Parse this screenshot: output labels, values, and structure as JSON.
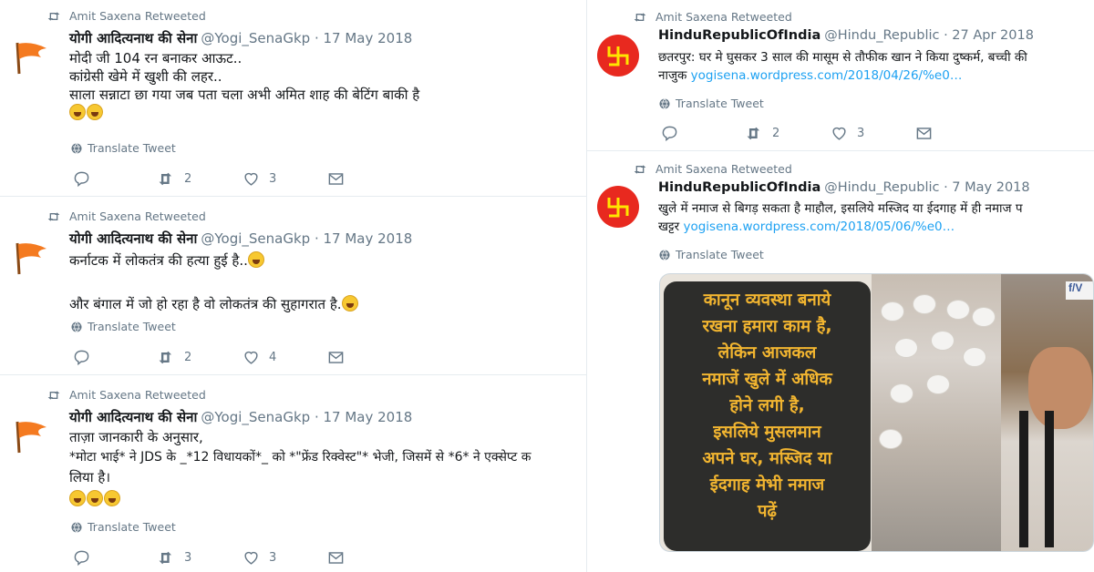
{
  "left_tweets": [
    {
      "retweeted_by": "Amit Saxena Retweeted",
      "name": "योगी आदित्यनाथ की सेना",
      "meta": "@Yogi_SenaGkp · 17 May 2018",
      "lines": [
        "मोदी जी 104 रन बनाकर आऊट..",
        "कांग्रेसी खेमे में खुशी की लहर..",
        "साला सन्नाटा छा गया जब पता चला अभी अमित शाह की बेटिंग बाकी है"
      ],
      "translate": "Translate Tweet",
      "reply_count": "",
      "retweet_count": "2",
      "like_count": "3"
    },
    {
      "retweeted_by": "Amit Saxena Retweeted",
      "name": "योगी आदित्यनाथ की सेना",
      "meta": "@Yogi_SenaGkp · 17 May 2018",
      "lines": [
        "कर्नाटक में लोकतंत्र की हत्या हुई है..",
        "",
        "और बंगाल में जो हो रहा है वो लोकतंत्र की सुहागरात है."
      ],
      "translate": "Translate Tweet",
      "reply_count": "",
      "retweet_count": "2",
      "like_count": "4"
    },
    {
      "retweeted_by": "Amit Saxena Retweeted",
      "name": "योगी आदित्यनाथ की सेना",
      "meta": "@Yogi_SenaGkp · 17 May 2018",
      "lines": [
        "ताज़ा जानकारी के अनुसार,",
        "*मोटा भाई* ने JDS के _*12 विधायकों*_ को *\"फ्रेंड रिक्वेस्ट\"* भेजी, जिसमें से *6* ने एक्सेप्ट क",
        "लिया है।"
      ],
      "translate": "Translate Tweet",
      "reply_count": "",
      "retweet_count": "3",
      "like_count": "3"
    }
  ],
  "right_tweets": [
    {
      "retweeted_by": "Amit Saxena Retweeted",
      "name": "HinduRepublicOfIndia",
      "meta": "@Hindu_Republic · 27 Apr 2018",
      "line1": "छतरपुर: घर मे घुसकर 3 साल की मासूम से तौफीक खान ने किया दुष्कर्म, बच्ची की",
      "line2_prefix": "नाजुक ",
      "link": "yogisena.wordpress.com/2018/04/26/%e0…",
      "translate": "Translate Tweet",
      "reply_count": "",
      "retweet_count": "2",
      "like_count": "3"
    },
    {
      "retweeted_by": "Amit Saxena Retweeted",
      "name": "HinduRepublicOfIndia",
      "meta": "@Hindu_Republic · 7 May 2018",
      "line1": "खुले में नमाज से बिगड़ सकता है माहौल, इसलिये मस्जिद या ईदगाह में ही नमाज प",
      "line2_prefix": "खट्टर ",
      "link": "yogisena.wordpress.com/2018/05/06/%e0…",
      "translate": "Translate Tweet",
      "image_text": [
        "कानून व्यवस्था बनाये",
        "रखना हमारा काम है,",
        "लेकिन आजकल",
        "नमाजें खुले में अधिक",
        "होने लगी है,",
        "इसलिये मुसलमान",
        "अपने घर, मस्जिद या",
        "ईदगाह मेभी नमाज",
        "पढ़ें"
      ],
      "image_tag": "f/V"
    }
  ],
  "colors": {
    "text": "#14171a",
    "secondary": "#657786",
    "link": "#1da1f2",
    "overlay_text": "#f2b530",
    "divider": "#e6ecf0",
    "avatar_red": "#e8291f",
    "flag_orange": "#f47a20"
  },
  "icons": {
    "retweeted": "retweet-icon",
    "reply": "reply-icon",
    "retweet": "retweet-icon",
    "like": "heart-icon",
    "dm": "envelope-icon",
    "translate": "globe-icon"
  }
}
